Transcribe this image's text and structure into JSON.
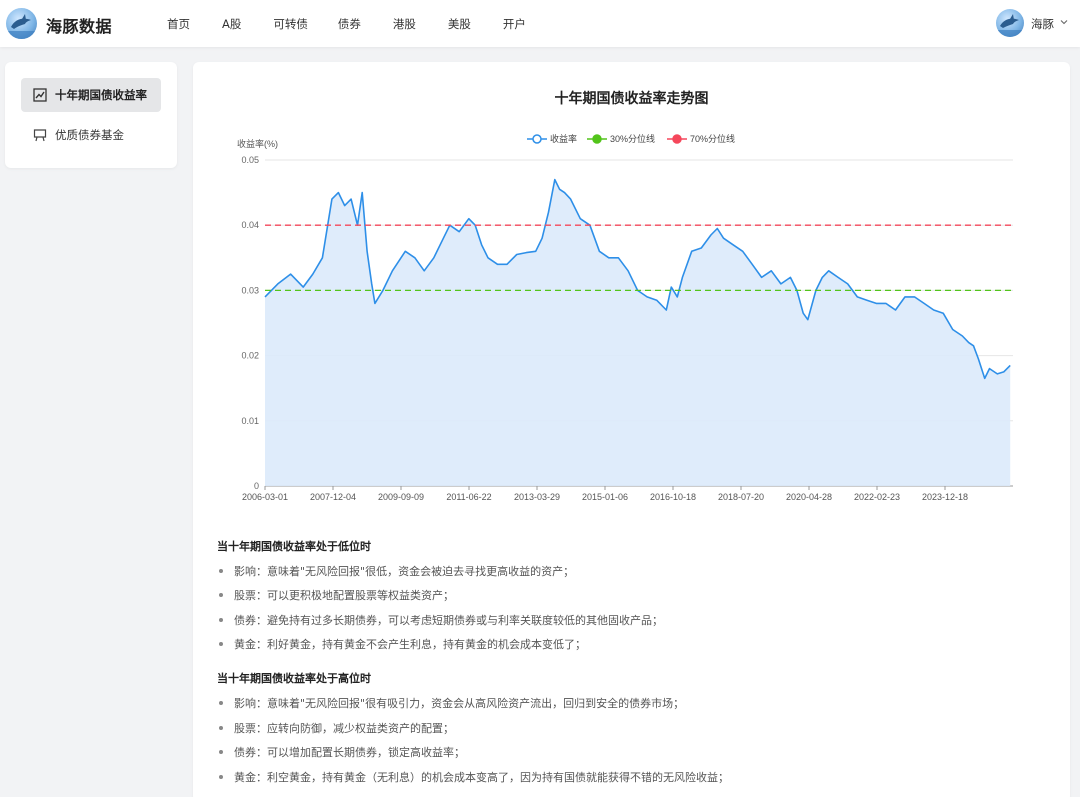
{
  "brand": {
    "name": "海豚数据"
  },
  "nav": {
    "items": [
      "首页",
      "A股",
      "可转债",
      "债券",
      "港股",
      "美股",
      "开户"
    ]
  },
  "user": {
    "name": "海豚"
  },
  "sidebar": {
    "items": [
      {
        "label": "十年期国债收益率",
        "active": true,
        "icon": "line-chart-icon"
      },
      {
        "label": "优质债券基金",
        "active": false,
        "icon": "presentation-board-icon"
      }
    ]
  },
  "colors": {
    "yield": "#2e8fe8",
    "p30": "#52c41a",
    "p70": "#f5475b",
    "area": "#dbeafb"
  },
  "chart_data": {
    "type": "area",
    "title": "十年期国债收益率走势图",
    "ylabel": "收益率(%)",
    "ylim": [
      0,
      0.05
    ],
    "yticks": [
      "0",
      "0.01",
      "0.02",
      "0.03",
      "0.04",
      "0.05"
    ],
    "xticks": [
      "2006-03-01",
      "2007-12-04",
      "2009-09-09",
      "2011-06-22",
      "2013-03-29",
      "2015-01-06",
      "2016-10-18",
      "2018-07-20",
      "2020-04-28",
      "2022-02-23",
      "2023-12-18"
    ],
    "legend_position": "top-center",
    "grid": true,
    "series": [
      {
        "name": "收益率",
        "kind": "area-line"
      },
      {
        "name": "30%分位线",
        "kind": "dashed",
        "value": 0.03
      },
      {
        "name": "70%分位线",
        "kind": "dashed",
        "value": 0.04
      }
    ],
    "x": [
      "2006-03-01",
      "2006-07-01",
      "2006-11-01",
      "2007-03-01",
      "2007-06-01",
      "2007-09-01",
      "2007-12-01",
      "2008-02-01",
      "2008-04-01",
      "2008-06-01",
      "2008-08-01",
      "2008-09-15",
      "2008-11-01",
      "2008-12-15",
      "2009-01-15",
      "2009-04-01",
      "2009-07-01",
      "2009-11-01",
      "2010-02-01",
      "2010-05-01",
      "2010-08-01",
      "2010-11-01",
      "2011-01-01",
      "2011-04-01",
      "2011-07-01",
      "2011-09-01",
      "2011-11-01",
      "2012-01-01",
      "2012-04-01",
      "2012-07-01",
      "2012-10-01",
      "2013-01-01",
      "2013-04-01",
      "2013-06-01",
      "2013-08-01",
      "2013-10-01",
      "2013-11-15",
      "2014-01-01",
      "2014-03-01",
      "2014-06-01",
      "2014-09-01",
      "2014-12-01",
      "2015-03-01",
      "2015-06-01",
      "2015-09-01",
      "2015-12-01",
      "2016-03-01",
      "2016-06-01",
      "2016-09-01",
      "2016-10-18",
      "2016-12-15",
      "2017-02-01",
      "2017-05-01",
      "2017-08-01",
      "2017-11-01",
      "2018-01-01",
      "2018-03-01",
      "2018-06-01",
      "2018-09-01",
      "2018-12-01",
      "2019-03-01",
      "2019-06-01",
      "2019-09-01",
      "2019-12-01",
      "2020-02-01",
      "2020-04-01",
      "2020-05-15",
      "2020-08-01",
      "2020-10-01",
      "2020-12-01",
      "2021-03-01",
      "2021-06-01",
      "2021-09-01",
      "2021-12-01",
      "2022-03-01",
      "2022-06-01",
      "2022-09-01",
      "2022-12-01",
      "2023-03-01",
      "2023-06-01",
      "2023-09-01",
      "2023-12-01",
      "2024-03-01",
      "2024-06-01",
      "2024-08-01",
      "2024-09-15",
      "2024-11-01",
      "2025-01-01",
      "2025-02-15",
      "2025-05-01",
      "2025-07-01",
      "2025-09-01"
    ],
    "values": [
      0.029,
      0.031,
      0.0325,
      0.0305,
      0.0325,
      0.035,
      0.044,
      0.045,
      0.043,
      0.044,
      0.04,
      0.045,
      0.036,
      0.031,
      0.028,
      0.03,
      0.033,
      0.036,
      0.035,
      0.033,
      0.035,
      0.038,
      0.04,
      0.039,
      0.041,
      0.04,
      0.037,
      0.035,
      0.034,
      0.034,
      0.0355,
      0.0358,
      0.036,
      0.038,
      0.042,
      0.047,
      0.0455,
      0.045,
      0.044,
      0.041,
      0.04,
      0.036,
      0.035,
      0.035,
      0.033,
      0.03,
      0.029,
      0.0285,
      0.027,
      0.0305,
      0.029,
      0.032,
      0.036,
      0.0365,
      0.0385,
      0.0395,
      0.038,
      0.037,
      0.036,
      0.034,
      0.032,
      0.033,
      0.031,
      0.032,
      0.03,
      0.0265,
      0.0255,
      0.03,
      0.032,
      0.033,
      0.032,
      0.031,
      0.029,
      0.0285,
      0.028,
      0.028,
      0.027,
      0.029,
      0.029,
      0.028,
      0.027,
      0.0265,
      0.024,
      0.023,
      0.022,
      0.0215,
      0.0195,
      0.0165,
      0.018,
      0.0172,
      0.0175,
      0.0185
    ]
  },
  "sections": [
    {
      "title": "当十年期国债收益率处于低位时",
      "items": [
        "影响：意味着\"无风险回报\"很低，资金会被迫去寻找更高收益的资产；",
        "股票：可以更积极地配置股票等权益类资产；",
        "债券：避免持有过多长期债券，可以考虑短期债券或与利率关联度较低的其他固收产品；",
        "黄金：利好黄金，持有黄金不会产生利息，持有黄金的机会成本变低了；"
      ]
    },
    {
      "title": "当十年期国债收益率处于高位时",
      "items": [
        "影响：意味着\"无风险回报\"很有吸引力，资金会从高风险资产流出，回归到安全的债券市场；",
        "股票：应转向防御，减少权益类资产的配置；",
        "债券：可以增加配置长期债券，锁定高收益率；",
        "黄金：利空黄金，持有黄金（无利息）的机会成本变高了，因为持有国债就能获得不错的无风险收益；"
      ]
    }
  ]
}
